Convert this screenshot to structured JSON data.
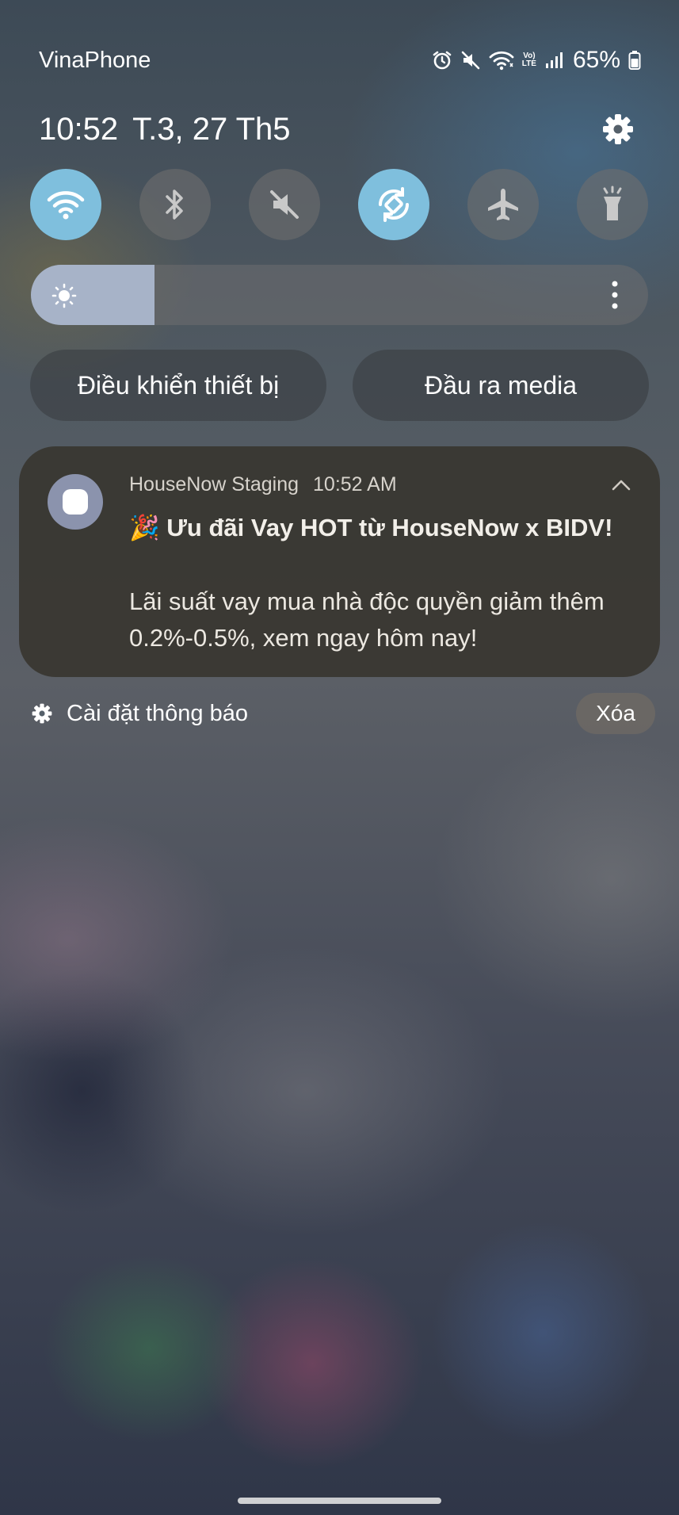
{
  "status_bar": {
    "carrier": "VinaPhone",
    "icons": [
      "alarm-icon",
      "mute-icon",
      "wifi-icon",
      "volte-icon",
      "signal-icon",
      "battery-icon"
    ],
    "volte_top": "Vo)",
    "volte_bottom": "LTE",
    "battery_percent": "65%"
  },
  "header": {
    "time": "10:52",
    "date": "T.3, 27 Th5"
  },
  "quick_settings": {
    "tiles": [
      {
        "name": "wifi",
        "icon": "wifi-icon",
        "active": true
      },
      {
        "name": "bluetooth",
        "icon": "bluetooth-icon",
        "active": false
      },
      {
        "name": "sound",
        "icon": "mute-icon",
        "active": false
      },
      {
        "name": "auto-rotate",
        "icon": "rotate-icon",
        "active": true
      },
      {
        "name": "airplane",
        "icon": "airplane-icon",
        "active": false
      },
      {
        "name": "flashlight",
        "icon": "flashlight-icon",
        "active": false
      }
    ],
    "brightness_level": 0.2,
    "active_color": "#7fbfdd"
  },
  "buttons": {
    "device_control": "Điều khiển thiết bị",
    "media_output": "Đầu ra media"
  },
  "notification": {
    "app_name": "HouseNow Staging",
    "time": "10:52 AM",
    "title": "🎉 Ưu đãi Vay HOT từ HouseNow x BIDV!",
    "body": "Lãi suất vay mua nhà độc quyền giảm thêm 0.2%-0.5%, xem ngay hôm nay!"
  },
  "footer": {
    "settings_label": "Cài đặt thông báo",
    "clear_label": "Xóa"
  }
}
